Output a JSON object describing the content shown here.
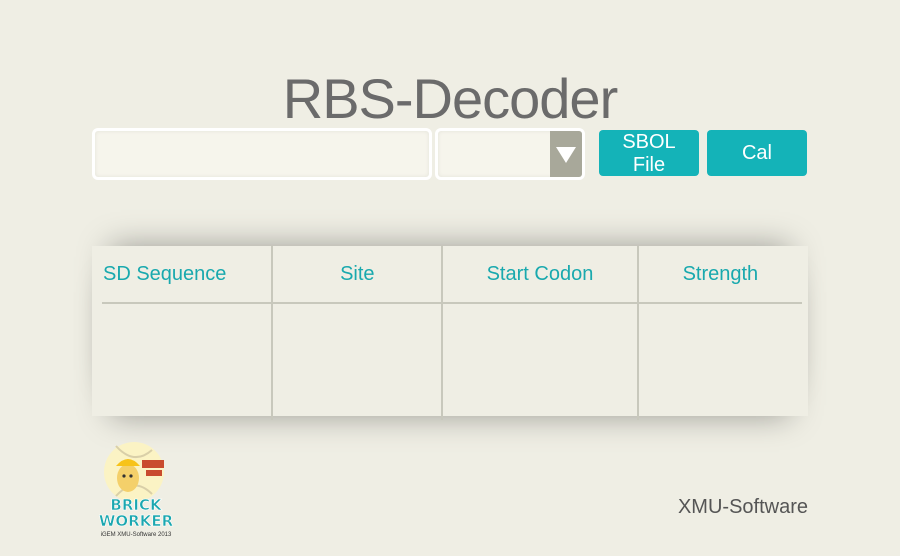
{
  "app": {
    "title": "RBS-Decoder"
  },
  "controls": {
    "sequence_value": "",
    "select_value": "",
    "sbol_button": "SBOL File",
    "cal_button": "Cal"
  },
  "results_table": {
    "headers": [
      "SD Sequence",
      "Site",
      "Start Codon",
      "Strength"
    ],
    "rows": []
  },
  "logo": {
    "line1": "BRICK",
    "line2": "WORKER",
    "tagline": "iGEM XMU-Software 2013"
  },
  "footer": {
    "credit": "XMU-Software"
  },
  "colors": {
    "accent": "#14b3b8",
    "background": "#efeee4",
    "title_text": "#6b6b6b"
  }
}
